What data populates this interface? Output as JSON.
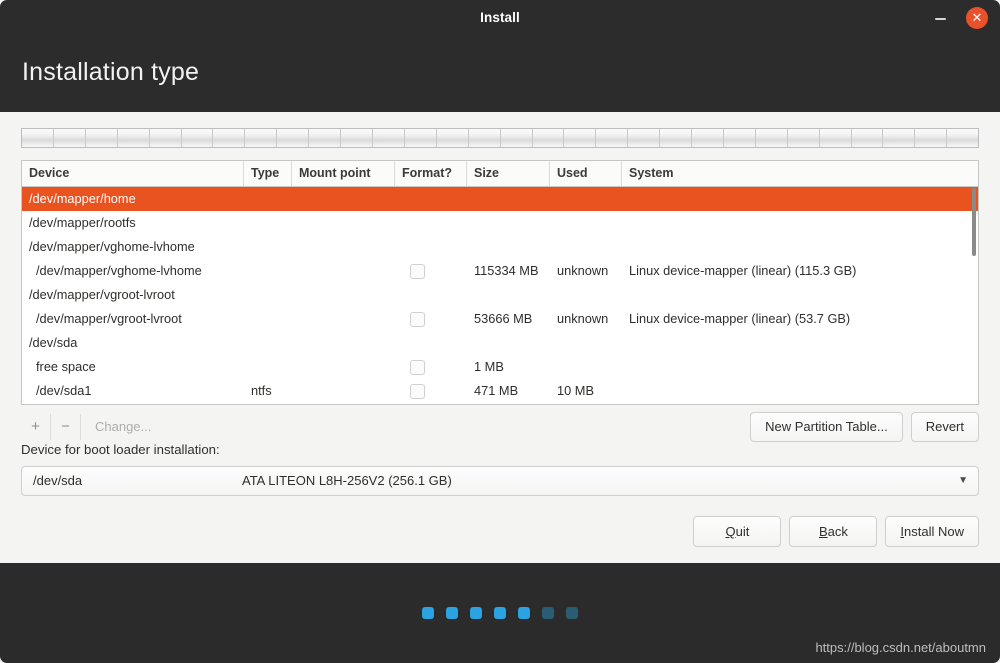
{
  "window": {
    "title": "Install",
    "minimize_icon": "minimize-icon",
    "close_icon": "close-icon",
    "accent_color": "#e8512a"
  },
  "header": {
    "page_title": "Installation type"
  },
  "partition_strip": {
    "segments": 30
  },
  "partition_table": {
    "columns": [
      "Device",
      "Type",
      "Mount point",
      "Format?",
      "Size",
      "Used",
      "System"
    ],
    "rows": [
      {
        "device": "/dev/mapper/home",
        "type": "",
        "mount": "",
        "format": false,
        "size": "",
        "used": "",
        "system": "",
        "child": false,
        "checkbox": false,
        "selected": true
      },
      {
        "device": "/dev/mapper/rootfs",
        "type": "",
        "mount": "",
        "format": false,
        "size": "",
        "used": "",
        "system": "",
        "child": false,
        "checkbox": false,
        "selected": false
      },
      {
        "device": "/dev/mapper/vghome-lvhome",
        "type": "",
        "mount": "",
        "format": false,
        "size": "",
        "used": "",
        "system": "",
        "child": false,
        "checkbox": false,
        "selected": false
      },
      {
        "device": "/dev/mapper/vghome-lvhome",
        "type": "",
        "mount": "",
        "format": false,
        "size": "115334 MB",
        "used": "unknown",
        "system": "Linux device-mapper (linear) (115.3 GB)",
        "child": true,
        "checkbox": true,
        "selected": false
      },
      {
        "device": "/dev/mapper/vgroot-lvroot",
        "type": "",
        "mount": "",
        "format": false,
        "size": "",
        "used": "",
        "system": "",
        "child": false,
        "checkbox": false,
        "selected": false
      },
      {
        "device": "/dev/mapper/vgroot-lvroot",
        "type": "",
        "mount": "",
        "format": false,
        "size": "53666 MB",
        "used": "unknown",
        "system": "Linux device-mapper (linear) (53.7 GB)",
        "child": true,
        "checkbox": true,
        "selected": false
      },
      {
        "device": "/dev/sda",
        "type": "",
        "mount": "",
        "format": false,
        "size": "",
        "used": "",
        "system": "",
        "child": false,
        "checkbox": false,
        "selected": false
      },
      {
        "device": "free space",
        "type": "",
        "mount": "",
        "format": false,
        "size": "1 MB",
        "used": "",
        "system": "",
        "child": true,
        "checkbox": true,
        "selected": false
      },
      {
        "device": "/dev/sda1",
        "type": "ntfs",
        "mount": "",
        "format": false,
        "size": "471 MB",
        "used": "10 MB",
        "system": "",
        "child": true,
        "checkbox": true,
        "selected": false
      }
    ]
  },
  "toolbar": {
    "add_label": "+",
    "remove_label": "−",
    "change_label": "Change...",
    "new_partition_table_label": "New Partition Table...",
    "revert_label": "Revert"
  },
  "bootloader": {
    "label": "Device for boot loader installation:",
    "selected_device": "/dev/sda",
    "selected_description": "ATA LITEON L8H-256V2 (256.1 GB)",
    "dropdown_icon": "▼"
  },
  "actions": {
    "quit": {
      "mnemonic": "Q",
      "rest": "uit"
    },
    "back": {
      "mnemonic": "B",
      "rest": "ack"
    },
    "install_now": {
      "mnemonic": "I",
      "rest": "nstall Now"
    }
  },
  "footer": {
    "dots": [
      true,
      true,
      true,
      true,
      true,
      false,
      false
    ],
    "watermark": "https://blog.csdn.net/aboutmn"
  }
}
